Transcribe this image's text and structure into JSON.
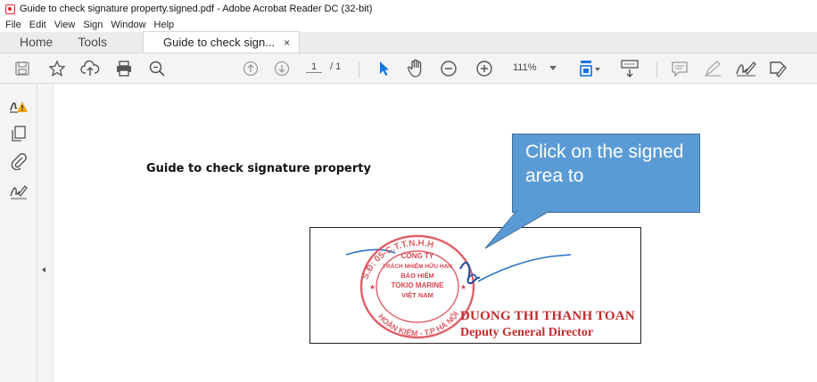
{
  "window": {
    "title": "Guide to check signature property.signed.pdf - Adobe Acrobat Reader DC (32-bit)"
  },
  "menu": [
    "File",
    "Edit",
    "View",
    "Sign",
    "Window",
    "Help"
  ],
  "tabs": {
    "home": "Home",
    "tools": "Tools",
    "document": "Guide to check sign...",
    "close": "×"
  },
  "toolbar": {
    "page_current": "1",
    "page_total": "/ 1",
    "zoom": "111%",
    "icons": [
      "save-icon",
      "bookmark-star-icon",
      "upload-cloud-icon",
      "print-icon",
      "search-zoom-icon",
      "page-up-icon",
      "page-down-icon",
      "select-arrow-icon",
      "hand-icon",
      "zoom-out-icon",
      "zoom-in-icon",
      "zoom-dropdown-icon",
      "fit-page-icon",
      "scroll-mode-icon",
      "comment-icon",
      "highlight-pen-icon",
      "sign-icon",
      "fill-sign-icon"
    ]
  },
  "sidebar_icons": [
    "signature-warning-icon",
    "pages-icon",
    "attachment-icon",
    "sign-tool-icon"
  ],
  "document": {
    "heading": "Guide to check signature property",
    "stamp_text": {
      "ring_top": "S.Đ: 05-C.T.T.N.H.H",
      "line1": "CÔNG TY",
      "line2": "TRÁCH NHIỆM HỮU HẠN",
      "line3": "BẢO HIỂM",
      "line4": "TOKIO MARINE",
      "line5": "VIỆT NAM",
      "ring_bottom": "HOÀN KIẾM - T.P HÀ NỘI"
    },
    "signer_name": "DUONG THI THANH TOAN",
    "signer_title": "Deputy General Director"
  },
  "callout": {
    "text": "Click on the signed area to"
  },
  "colors": {
    "accent_red": "#d9272e",
    "callout_blue": "#5b9bd5",
    "select_blue": "#1473e6",
    "stamp_red": "#d9444e",
    "signature_blue": "#2a74c6"
  }
}
